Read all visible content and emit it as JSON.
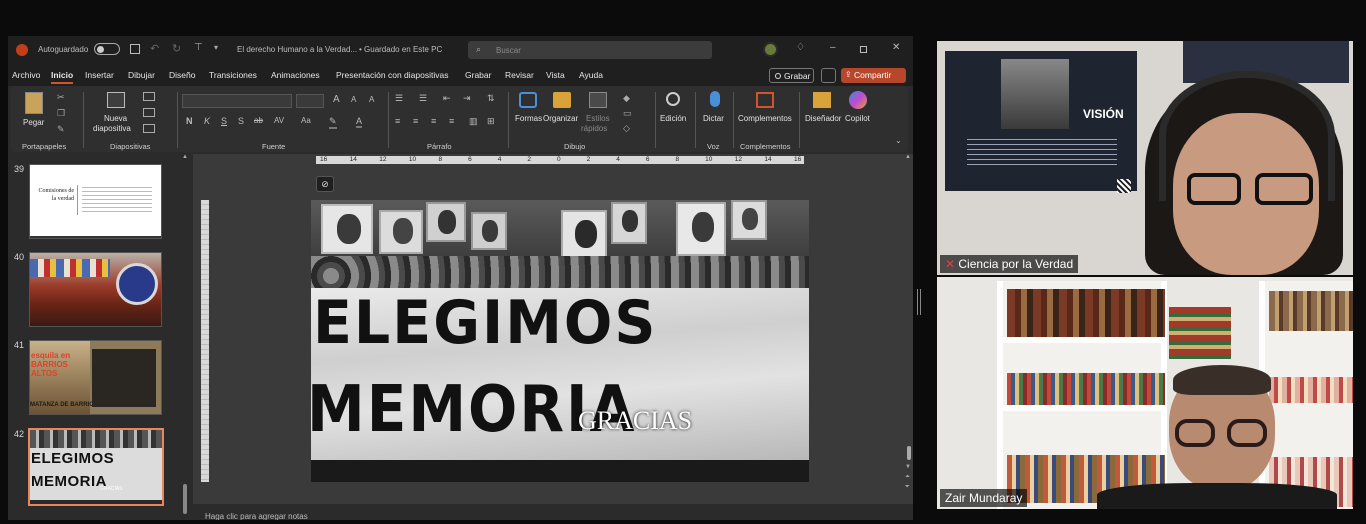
{
  "ppt": {
    "autosave_label": "Autoguardado",
    "doc_title": "El derecho Humano a la Verdad...",
    "save_status": "• Guardado en Este PC",
    "search_placeholder": "Buscar",
    "menu": [
      "Archivo",
      "Inicio",
      "Insertar",
      "Dibujar",
      "Diseño",
      "Transiciones",
      "Animaciones",
      "Presentación con diapositivas",
      "Grabar",
      "Revisar",
      "Vista",
      "Ayuda"
    ],
    "record_btn": "Grabar",
    "share_btn": "Compartir",
    "ribbon": {
      "paste": "Pegar",
      "new_slide": "Nueva",
      "new_slide2": "diapositiva",
      "shapes": "Formas",
      "arrange": "Organizar",
      "styles": "Estilos",
      "styles2": "rápidos",
      "editing": "Edición",
      "dictate": "Dictar",
      "addins": "Complementos",
      "designer": "Diseñador",
      "copilot": "Copilot",
      "groups": [
        "Portapapeles",
        "Diapositivas",
        "Fuente",
        "Párrafo",
        "Dibujo",
        "Voz",
        "Complementos"
      ]
    },
    "ruler_labels": [
      "16",
      "14",
      "12",
      "10",
      "8",
      "6",
      "4",
      "2",
      "0",
      "2",
      "4",
      "6",
      "8",
      "10",
      "12",
      "14",
      "16"
    ],
    "slides": [
      {
        "num": "39",
        "title": "Comisiones de la verdad"
      },
      {
        "num": "40"
      },
      {
        "num": "41",
        "text": "esquila en BARRIOS ALTOS",
        "text2": "MATANZA DE BARRIOS ALT"
      },
      {
        "num": "42",
        "line1": "ELEGIMOS",
        "line2": "MEMORIA",
        "caption": "GRACIAS"
      }
    ],
    "current_slide": {
      "line1": "ELEGIMOS",
      "line2": "MEMORIA",
      "caption": "GRACIAS"
    },
    "notes_placeholder": "Haga clic para agregar notas"
  },
  "video": {
    "tile1": {
      "name": "Ciencia por la Verdad",
      "poster_word": "VISIÓN"
    },
    "tile2": {
      "name": "Zair Mundaray"
    }
  },
  "colors": {
    "accent": "#c43e1c",
    "share": "#b7472a"
  }
}
